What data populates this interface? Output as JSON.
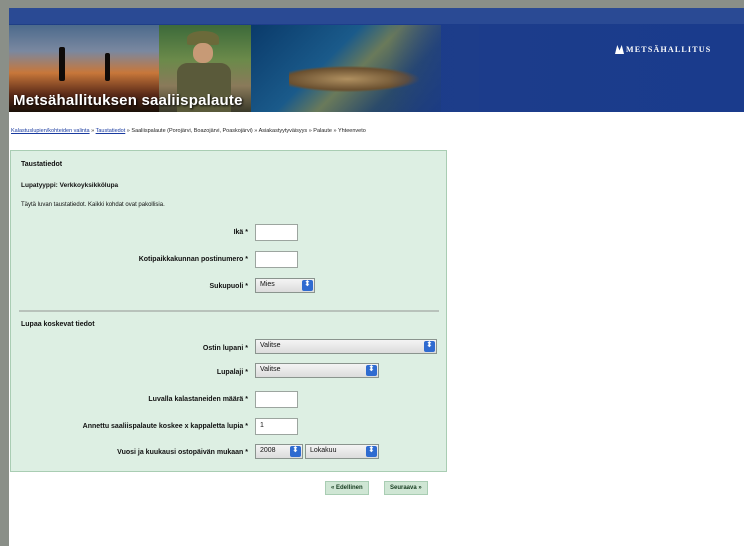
{
  "banner": {
    "title": "Metsähallituksen saaliispalaute",
    "brand": "METSÄHALLITUS"
  },
  "breadcrumb": {
    "link1": "Kalastuslupien/kohteiden valinta",
    "sep": " » ",
    "link2": "Taustatiedot",
    "rest": " » Saaliispalaute (Porojärvi, Boazojärvi, Poaskojärvi) » Asiakastyytyväisyys » Palaute » Yhteenveto"
  },
  "form": {
    "section1_title": "Taustatiedot",
    "permit_type": "Lupatyyppi: Verkkoyksikkölupa",
    "instructions": "Täytä luvan taustatiedot. Kaikki kohdat ovat pakollisia.",
    "age_label": "Ikä *",
    "age_value": "",
    "postcode_label": "Kotipaikkakunnan postinumero *",
    "postcode_value": "",
    "gender_label": "Sukupuoli *",
    "gender_value": "Mies",
    "section2_title": "Lupaa koskevat tiedot",
    "got_permit_label": "Ostin lupani *",
    "got_permit_value": "Valitse",
    "permit_kind_label": "Lupalaji *",
    "permit_kind_value": "Valitse",
    "fishers_label": "Luvalla kalastaneiden määrä *",
    "fishers_value": "",
    "feedback_count_label": "Annettu saaliispalaute koskee x kappaletta lupia *",
    "feedback_count_value": "1",
    "yearmonth_label": "Vuosi ja kuukausi ostopäivän mukaan *",
    "year_value": "2008",
    "month_value": "Lokakuu"
  },
  "nav": {
    "prev": "« Edellinen",
    "next": "Seuraava »"
  },
  "colors": {
    "banner": "#1f3f86",
    "panel": "#ddefe3",
    "accent_select": "#2f6bd0",
    "link": "#1a3ba0"
  }
}
